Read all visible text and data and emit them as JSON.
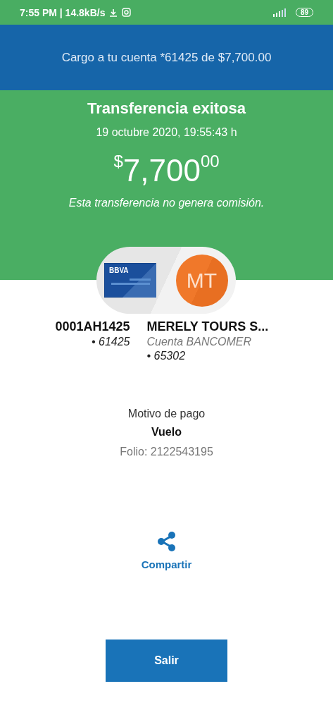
{
  "status_bar": {
    "time": "7:55 PM | 14.8kB/s",
    "battery": "89"
  },
  "header": {
    "title": "Cargo a tu cuenta *61425 de $7,700.00"
  },
  "result": {
    "title": "Transferencia exitosa",
    "date": "19 octubre 2020, 19:55:43 h",
    "currency": "$",
    "amount": "7,700",
    "cents": "00",
    "note": "Esta transferencia no genera comisión."
  },
  "origin": {
    "bank": "BBVA",
    "name": "0001AH1425",
    "account": "• 61425"
  },
  "destination": {
    "initials": "MT",
    "name": "MERELY TOURS S...",
    "bank": "Cuenta BANCOMER",
    "account": "• 65302"
  },
  "details": {
    "label": "Motivo de pago",
    "value": "Vuelo",
    "folio": "Folio: 2122543195"
  },
  "share": {
    "label": "Compartir"
  },
  "buttons": [
    "Salir"
  ]
}
